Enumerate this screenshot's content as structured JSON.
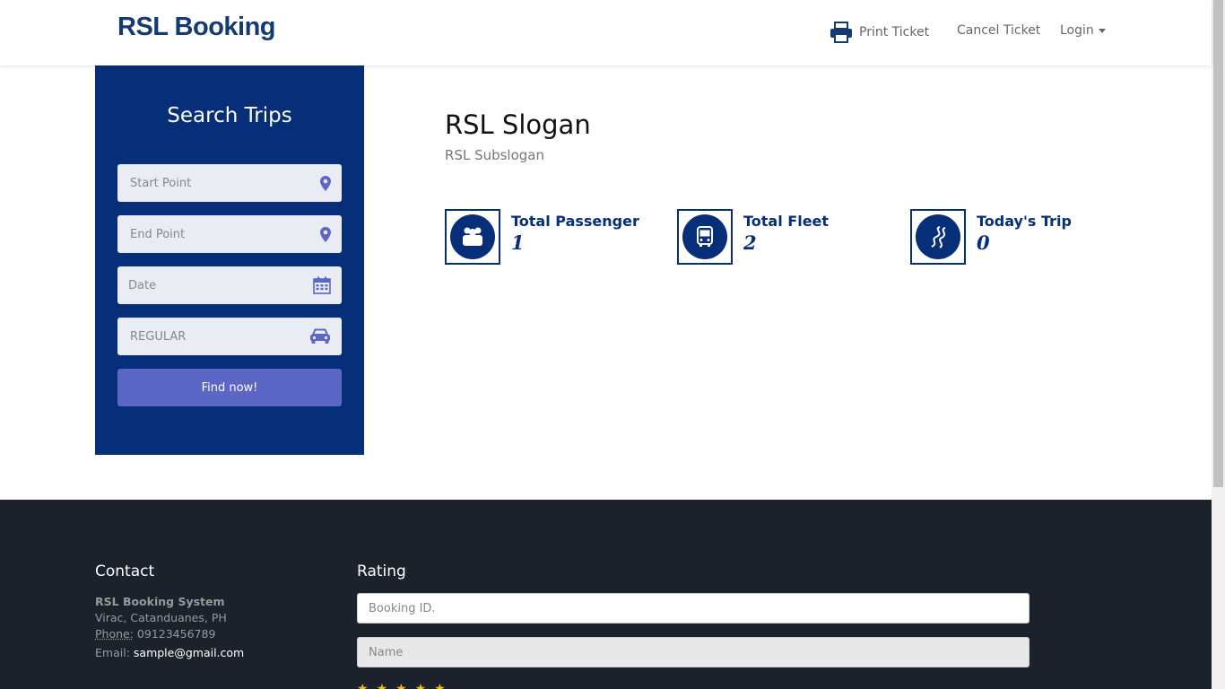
{
  "header": {
    "brand": "RSL Booking",
    "nav": {
      "print_ticket": "Print Ticket",
      "cancel_ticket": "Cancel Ticket",
      "login": "Login"
    }
  },
  "search": {
    "title": "Search Trips",
    "start_point_placeholder": "Start Point",
    "end_point_placeholder": "End Point",
    "date_placeholder": "Date",
    "class_value": "REGULAR",
    "find_button": "Find now!"
  },
  "hero": {
    "slogan": "RSL Slogan",
    "subslogan": "RSL Subslogan"
  },
  "stats": [
    {
      "label": "Total Passenger",
      "value": "1",
      "icon": "passengers-icon"
    },
    {
      "label": "Total Fleet",
      "value": "2",
      "icon": "bus-icon"
    },
    {
      "label": "Today's Trip",
      "value": "0",
      "icon": "road-icon"
    }
  ],
  "footer": {
    "contact": {
      "heading": "Contact",
      "name": "RSL Booking System",
      "address": "Virac, Catanduanes, PH",
      "phone_label": "Phone:",
      "phone": "09123456789",
      "email_label": "Email:",
      "email": "sample@gmail.com"
    },
    "rating": {
      "heading": "Rating",
      "booking_id_placeholder": "Booking ID.",
      "name_placeholder": "Name"
    }
  },
  "colors": {
    "primary": "#072f79",
    "button": "#5a67c4",
    "footer_bg": "#1c222c",
    "star": "#f0b72a"
  }
}
